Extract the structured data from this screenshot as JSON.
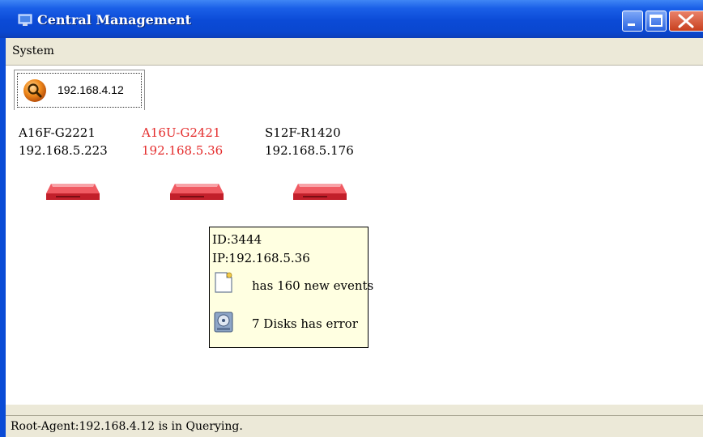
{
  "window": {
    "title": "Central Management"
  },
  "menu": {
    "items": [
      "System"
    ]
  },
  "tabs": [
    {
      "label": "192.168.4.12",
      "icon": "search-icon",
      "selected": true
    }
  ],
  "devices": [
    {
      "name": "A16F-G2221",
      "ip": "192.168.5.223",
      "alert": false,
      "icon": "network-switch-icon"
    },
    {
      "name": "A16U-G2421",
      "ip": "192.168.5.36",
      "alert": true,
      "icon": "network-switch-icon"
    },
    {
      "name": "S12F-R1420",
      "ip": "192.168.5.176",
      "alert": false,
      "icon": "network-switch-icon"
    }
  ],
  "tooltip": {
    "id_line": "ID:3444",
    "ip_line": "IP:192.168.5.36",
    "events_text": "has 160 new events",
    "events_icon": "document-icon",
    "disks_text": "7 Disks has error",
    "disks_icon": "hard-disk-icon"
  },
  "status": {
    "text": "Root-Agent:192.168.4.12 is in Querying."
  },
  "colors": {
    "titlebar": "#0a4bd6",
    "alert_text": "#e42b2b",
    "switch_red": "#e3343d",
    "tooltip_bg": "#ffffe1"
  }
}
